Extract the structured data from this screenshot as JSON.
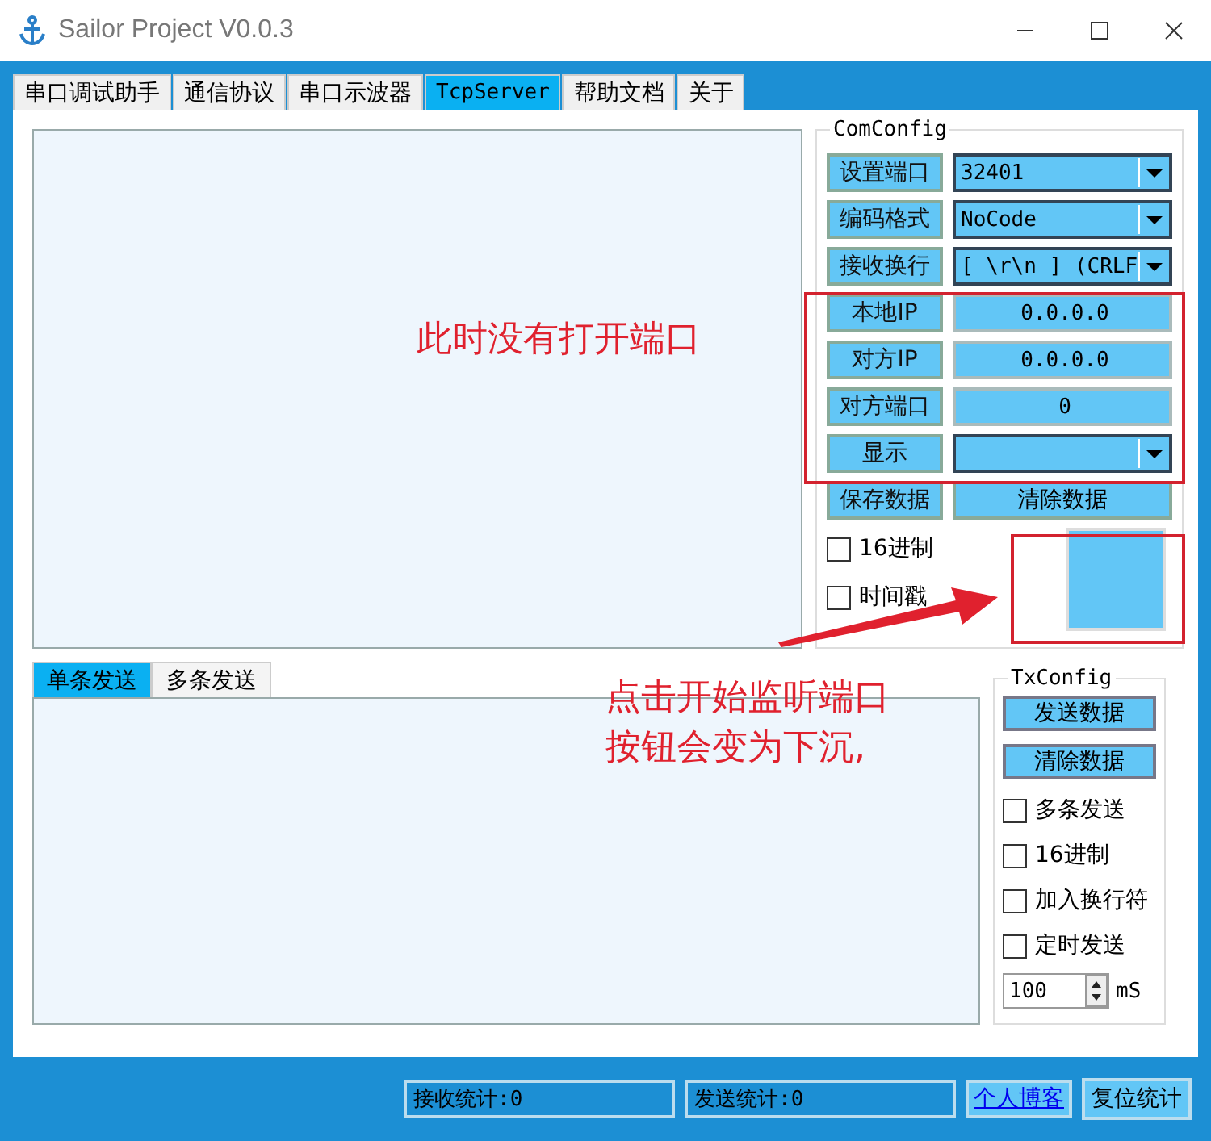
{
  "window": {
    "title": "Sailor Project V0.0.3"
  },
  "tabs": [
    {
      "label": "串口调试助手",
      "selected": false
    },
    {
      "label": "通信协议",
      "selected": false
    },
    {
      "label": "串口示波器",
      "selected": false
    },
    {
      "label": "TcpServer",
      "selected": true
    },
    {
      "label": "帮助文档",
      "selected": false
    },
    {
      "label": "关于",
      "selected": false
    }
  ],
  "com_config": {
    "title": "ComConfig",
    "rows": [
      {
        "kind": "select",
        "label": "设置端口",
        "value": "32401"
      },
      {
        "kind": "select",
        "label": "编码格式",
        "value": "NoCode"
      },
      {
        "kind": "select",
        "label": "接收换行",
        "value": "[ \\r\\n ] (CRLF"
      },
      {
        "kind": "value",
        "label": "本地IP",
        "value": "0.0.0.0"
      },
      {
        "kind": "value",
        "label": "对方IP",
        "value": "0.0.0.0"
      },
      {
        "kind": "value",
        "label": "对方端口",
        "value": "0"
      },
      {
        "kind": "select",
        "label": "显示",
        "value": ""
      },
      {
        "kind": "buttons",
        "label": "保存数据",
        "value": "清除数据"
      }
    ],
    "checkboxes": [
      {
        "label": "16进制",
        "checked": false
      },
      {
        "label": "时间戳",
        "checked": false
      }
    ],
    "listen_button": {
      "pressed": false
    }
  },
  "send_tabs": [
    {
      "label": "单条发送",
      "selected": true
    },
    {
      "label": "多条发送",
      "selected": false
    }
  ],
  "tx_config": {
    "title": "TxConfig",
    "buttons": [
      "发送数据",
      "清除数据"
    ],
    "checkboxes": [
      {
        "label": "多条发送",
        "checked": false
      },
      {
        "label": "16进制",
        "checked": false
      },
      {
        "label": "加入换行符",
        "checked": false
      },
      {
        "label": "定时发送",
        "checked": false
      }
    ],
    "interval": "100",
    "unit": "mS"
  },
  "status_bar": {
    "received": "接收统计:0",
    "sent": "发送统计:0",
    "link": "个人博客",
    "reset": "复位统计"
  },
  "annotations": [
    "此时没有打开端口",
    "点击开始监听端口",
    "按钮会变为下沉,"
  ]
}
